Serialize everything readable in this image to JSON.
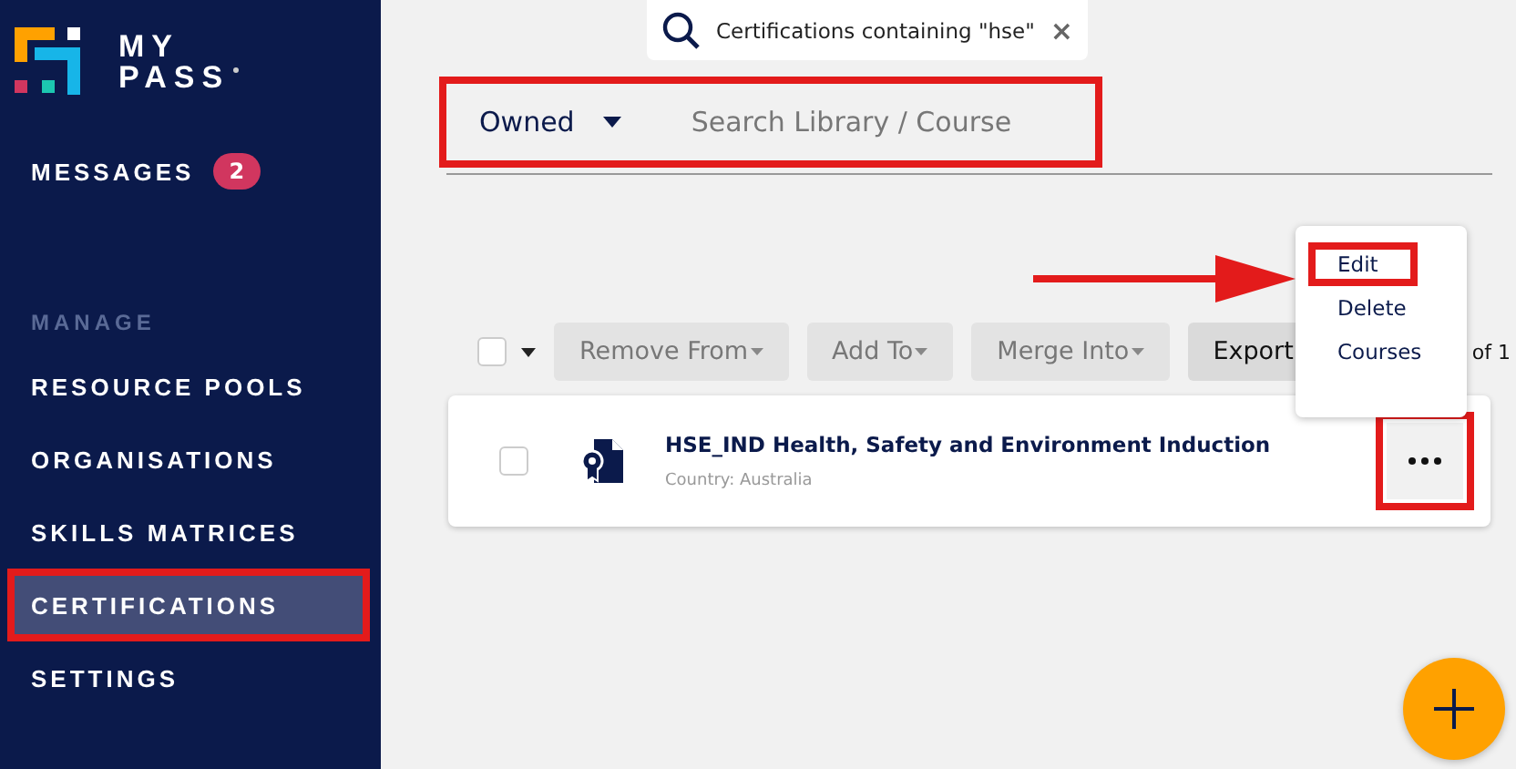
{
  "brand": {
    "line1": "MY",
    "line2": "PASS"
  },
  "messages": {
    "label": "MESSAGES",
    "count": "2"
  },
  "sidebar": {
    "section": "MANAGE",
    "items": [
      {
        "label": "RESOURCE POOLS",
        "selected": false,
        "highlighted": false
      },
      {
        "label": "ORGANISATIONS",
        "selected": false,
        "highlighted": false
      },
      {
        "label": "SKILLS MATRICES",
        "selected": false,
        "highlighted": false
      },
      {
        "label": "CERTIFICATIONS",
        "selected": true,
        "highlighted": true
      },
      {
        "label": "SETTINGS",
        "selected": false,
        "highlighted": false
      }
    ]
  },
  "search_chip": {
    "text": "Certifications containing \"hse\"",
    "close": "×"
  },
  "filter": {
    "highlighted": true,
    "dropdown": "Owned",
    "search": {
      "placeholder": "Search Library / Course"
    }
  },
  "toolbar": {
    "select_all": {
      "checked": false
    },
    "buttons": [
      {
        "label": "Remove From",
        "disabled": true
      },
      {
        "label": "Add To",
        "disabled": true
      },
      {
        "label": "Merge Into",
        "disabled": true
      },
      {
        "label": "Export",
        "disabled": false
      }
    ],
    "pager": "of 1"
  },
  "rows": [
    {
      "title": "HSE_IND Health, Safety and Environment Induction",
      "subtitle": "Country: Australia",
      "checked": false,
      "more_highlighted": true
    }
  ],
  "menu": {
    "items": [
      {
        "label": "Edit",
        "highlighted": true
      },
      {
        "label": "Delete",
        "highlighted": false
      },
      {
        "label": "Courses",
        "highlighted": false
      }
    ]
  }
}
